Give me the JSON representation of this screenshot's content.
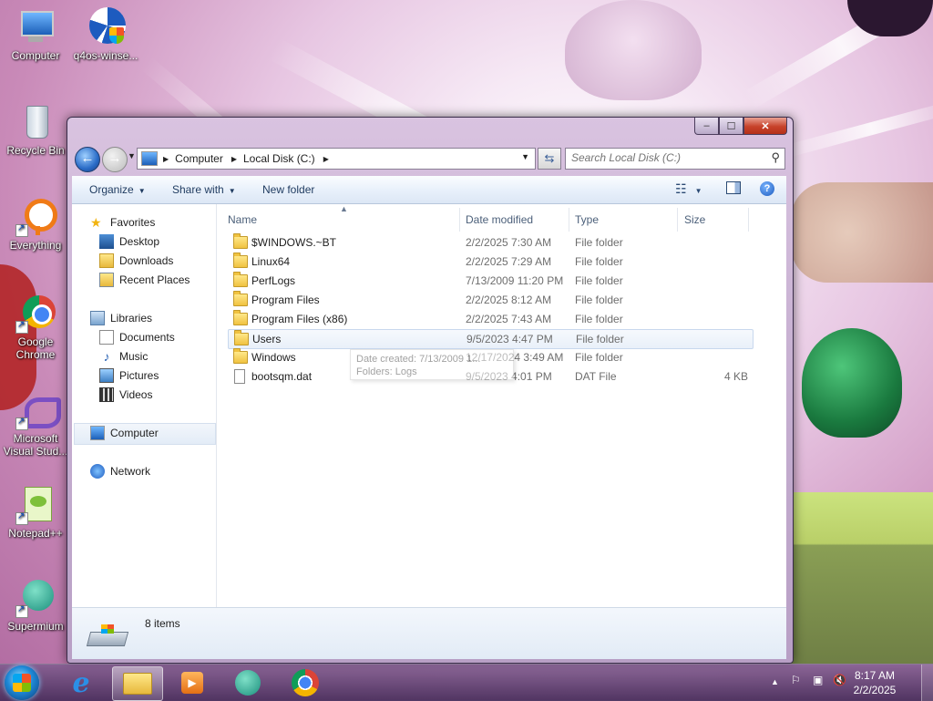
{
  "desktop": {
    "icons": [
      {
        "label": "Computer"
      },
      {
        "label": "q4os-winse..."
      },
      {
        "label": "Recycle Bin"
      },
      {
        "label": "Everything"
      },
      {
        "label": "Google Chrome"
      },
      {
        "label": "Microsoft Visual Stud..."
      },
      {
        "label": "Notepad++"
      },
      {
        "label": "Supermium"
      }
    ]
  },
  "window": {
    "controls": {
      "minimize": "–",
      "maximize": "☐",
      "close": "✕"
    },
    "address": {
      "crumbs": [
        "Computer",
        "Local Disk (C:)"
      ]
    },
    "search": {
      "placeholder": "Search Local Disk (C:)"
    },
    "toolbar": {
      "organize": "Organize",
      "share_with": "Share with",
      "new_folder": "New folder"
    },
    "nav_pane": {
      "favorites": "Favorites",
      "favorites_items": [
        "Desktop",
        "Downloads",
        "Recent Places"
      ],
      "libraries": "Libraries",
      "libraries_items": [
        "Documents",
        "Music",
        "Pictures",
        "Videos"
      ],
      "computer": "Computer",
      "network": "Network"
    },
    "columns": {
      "name": "Name",
      "date_modified": "Date modified",
      "type": "Type",
      "size": "Size"
    },
    "files": [
      {
        "name": "$WINDOWS.~BT",
        "date": "2/2/2025 7:30 AM",
        "type": "File folder",
        "size": "",
        "kind": "folder"
      },
      {
        "name": "Linux64",
        "date": "2/2/2025 7:29 AM",
        "type": "File folder",
        "size": "",
        "kind": "folder"
      },
      {
        "name": "PerfLogs",
        "date": "7/13/2009 11:20 PM",
        "type": "File folder",
        "size": "",
        "kind": "folder"
      },
      {
        "name": "Program Files",
        "date": "2/2/2025 8:12 AM",
        "type": "File folder",
        "size": "",
        "kind": "folder"
      },
      {
        "name": "Program Files (x86)",
        "date": "2/2/2025 7:43 AM",
        "type": "File folder",
        "size": "",
        "kind": "folder"
      },
      {
        "name": "Users",
        "date": "9/5/2023 4:47 PM",
        "type": "File folder",
        "size": "",
        "kind": "folder"
      },
      {
        "name": "Windows",
        "date": "12/17/2024 3:49 AM",
        "type": "File folder",
        "size": "",
        "kind": "folder"
      },
      {
        "name": "bootsqm.dat",
        "date": "9/5/2023 4:01 PM",
        "type": "DAT File",
        "size": "4 KB",
        "kind": "file"
      }
    ],
    "tooltip": {
      "line1": "Date created: 7/13/2009 1...",
      "line2": "Folders: Logs"
    },
    "status": {
      "count": "8 items"
    }
  },
  "taskbar": {
    "clock_time": "8:17 AM",
    "clock_date": "2/2/2025",
    "tray_arrow": "▲"
  },
  "colors": {
    "accent": "#1e88d6",
    "selection": "#e9f0f9",
    "close_red": "#c7422a"
  }
}
